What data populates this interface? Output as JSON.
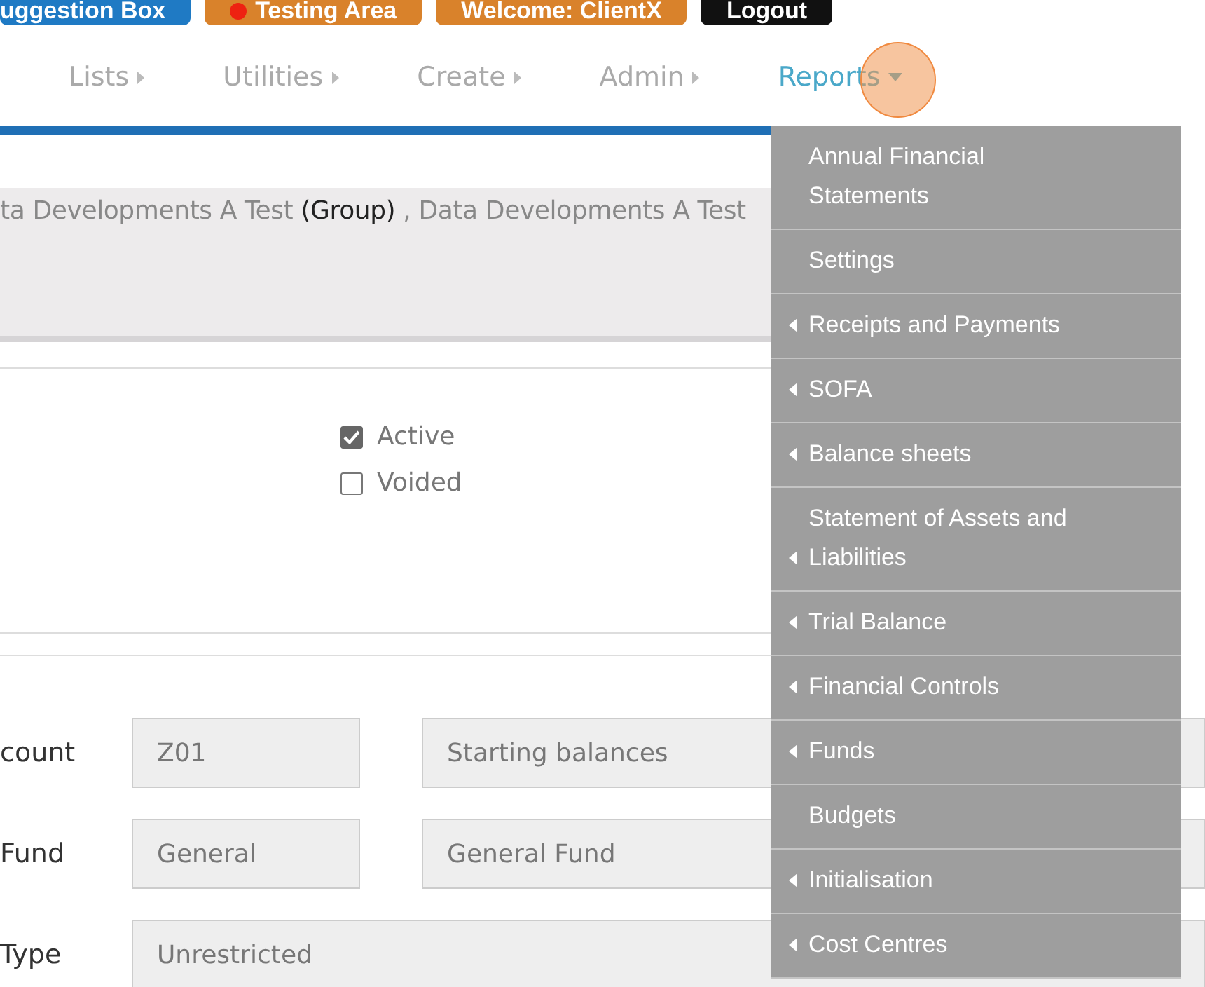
{
  "top_buttons": [
    {
      "label": "uggestion Box",
      "kind": "primary"
    },
    {
      "label": "Testing Area",
      "kind": "warning",
      "dot": true
    },
    {
      "label": "Welcome: ClientX",
      "kind": "warning",
      "dot": false
    },
    {
      "label": "Logout",
      "kind": "dark"
    }
  ],
  "nav": [
    {
      "label": "Lists",
      "selected": false
    },
    {
      "label": "Utilities",
      "selected": false
    },
    {
      "label": "Create",
      "selected": false
    },
    {
      "label": "Admin",
      "selected": false
    },
    {
      "label": "Reports",
      "selected": true
    }
  ],
  "context_text": "ta Developments A Test **(Group)** , Data Developments A Test",
  "checkboxes": [
    {
      "label": "Active",
      "checked": true
    },
    {
      "label": "Voided",
      "checked": false
    }
  ],
  "form_rows": [
    {
      "label": "count",
      "fields": [
        "Z01",
        "Starting balances"
      ]
    },
    {
      "label": "Fund",
      "fields": [
        "General",
        "General Fund"
      ]
    },
    {
      "label": "Type",
      "fields": [
        "Unrestricted"
      ]
    }
  ],
  "reports_menu": [
    {
      "label": "Annual Financial Statements",
      "submenu": false
    },
    {
      "label": "Settings",
      "submenu": false
    },
    {
      "label": "Receipts and Payments",
      "submenu": true
    },
    {
      "label": "SOFA",
      "submenu": true
    },
    {
      "label": "Balance sheets",
      "submenu": true
    },
    {
      "label": "Statement of Assets and Liabilities",
      "submenu": true
    },
    {
      "label": "Trial Balance",
      "submenu": true
    },
    {
      "label": "Financial Controls",
      "submenu": true
    },
    {
      "label": "Funds",
      "submenu": true
    },
    {
      "label": "Budgets",
      "submenu": false
    },
    {
      "label": "Initialisation",
      "submenu": true
    },
    {
      "label": "Cost Centres",
      "submenu": true
    }
  ]
}
